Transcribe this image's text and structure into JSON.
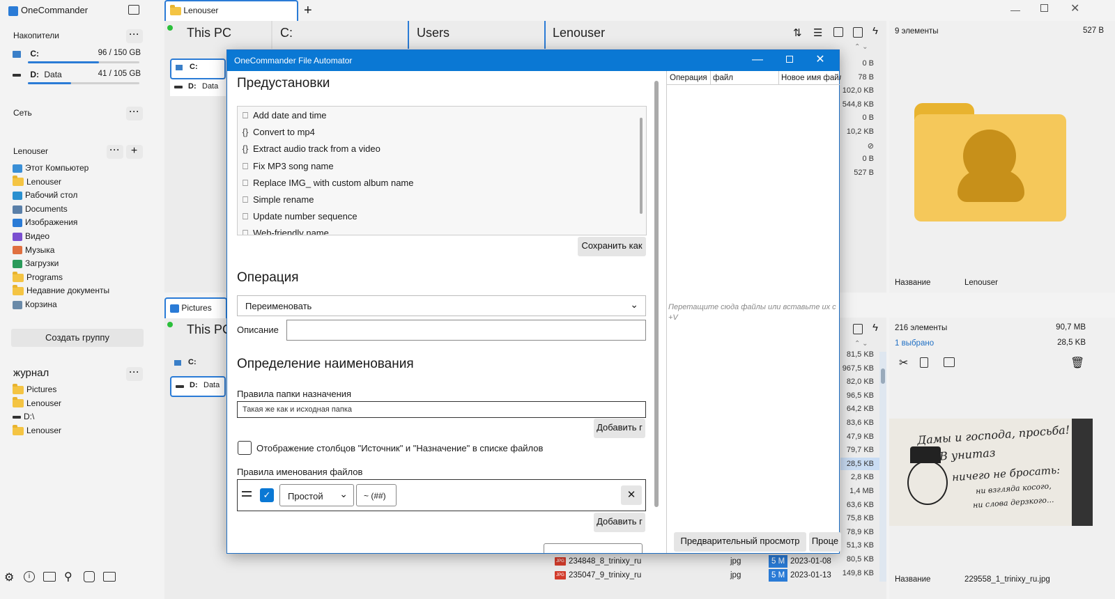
{
  "app": {
    "title": "OneCommander"
  },
  "sidebar": {
    "drives_header": "Накопители",
    "drives": [
      {
        "letter": "C:",
        "name": "",
        "usage": "96 / 150 GB",
        "fill": 0.64
      },
      {
        "letter": "D:",
        "name": "Data",
        "usage": "41 / 105 GB",
        "fill": 0.39
      }
    ],
    "network_header": "Сеть",
    "user_header": "Lenouser",
    "user_items": [
      {
        "label": "Этот Компьютер",
        "icon": "computer-icon"
      },
      {
        "label": "Lenouser",
        "icon": "folder-icon"
      },
      {
        "label": "Рабочий стол",
        "icon": "desktop-icon"
      },
      {
        "label": "Documents",
        "icon": "documents-icon"
      },
      {
        "label": "Изображения",
        "icon": "pictures-icon"
      },
      {
        "label": "Видео",
        "icon": "video-icon"
      },
      {
        "label": "Музыка",
        "icon": "music-icon"
      },
      {
        "label": "Загрузки",
        "icon": "downloads-icon"
      },
      {
        "label": "Programs",
        "icon": "folder-icon"
      },
      {
        "label": "Недавние документы",
        "icon": "folder-icon"
      },
      {
        "label": "Корзина",
        "icon": "recycle-bin-icon"
      }
    ],
    "create_group": "Создать группу",
    "journal_header": "журнал",
    "journal_items": [
      {
        "label": "Pictures",
        "icon": "folder-icon"
      },
      {
        "label": "Lenouser",
        "icon": "folder-icon"
      },
      {
        "label": "D:\\",
        "icon": "drive-icon"
      },
      {
        "label": "Lenouser",
        "icon": "folder-icon"
      }
    ]
  },
  "top_pane": {
    "tab_label": "Lenouser",
    "columns": [
      "This PC",
      "C:",
      "Users",
      "Lenouser"
    ],
    "drive_c": "C:",
    "drive_d": "D:",
    "drive_d_name": "Data",
    "sizes": [
      "0 B",
      "78 B",
      "102,0 KB",
      "544,8 KB",
      "0 B",
      "10,2 KB",
      "⊘",
      "0 B",
      "527 B"
    ]
  },
  "bottom_pane": {
    "tab_label": "Pictures",
    "column0": "This PC",
    "drive_c": "C:",
    "drive_d": "D:",
    "drive_d_name": "Data",
    "sizes": [
      "81,5 KB",
      "967,5 KB",
      "82,0 KB",
      "96,5 KB",
      "64,2 KB",
      "83,6 KB",
      "47,9 KB",
      "79,7 KB",
      "28,5 KB",
      "2,8 KB",
      "1,4 MB",
      "63,6 KB",
      "75,8 KB",
      "78,9 KB",
      "51,3 KB",
      "80,5 KB",
      "149,8 KB"
    ],
    "files": [
      {
        "name": "234848_8_trinixy_ru",
        "ext": "jpg",
        "badge": "5 M",
        "date": "2023-01-08"
      },
      {
        "name": "235047_9_trinixy_ru",
        "ext": "jpg",
        "badge": "5 M",
        "date": "2023-01-13"
      }
    ]
  },
  "right_top": {
    "count": "9 элементы",
    "size": "527 B",
    "name_label": "Название",
    "name_value": "Lenouser"
  },
  "right_bottom": {
    "count": "216 элементы",
    "size": "90,7 MB",
    "selected": "1 выбрано",
    "selected_size": "28,5 KB",
    "name_label": "Название",
    "name_value": "229558_1_trinixy_ru.jpg",
    "preview_text": [
      "Дамы и господа, просьба!",
      "В унитаз",
      "ничего не бросать:",
      "ни взгляда косого,",
      "ни слова дерзкого..."
    ]
  },
  "dialog": {
    "title": "OneCommander File Automator",
    "presets_header": "Предустановки",
    "presets": [
      {
        "icon": "book",
        "label": "Add date and time"
      },
      {
        "icon": "braces",
        "label": "Convert to mp4"
      },
      {
        "icon": "braces",
        "label": "Extract audio track from a video"
      },
      {
        "icon": "book",
        "label": "Fix MP3 song name"
      },
      {
        "icon": "book",
        "label": "Replace IMG_ with custom album name"
      },
      {
        "icon": "book",
        "label": "Simple rename"
      },
      {
        "icon": "book",
        "label": "Update number sequence"
      },
      {
        "icon": "book",
        "label": "Web-friendly name"
      }
    ],
    "save_as": "Сохранить как",
    "operation_header": "Операция",
    "operation_value": "Переименовать",
    "description_label": "Описание",
    "description_value": "",
    "naming_header": "Определение наименования",
    "dest_rules_label": "Правила папки назначения",
    "dest_rules_placeholder": "Такая же как и исходная папка",
    "add_button_1": "Добавить г",
    "show_columns_label": "Отображение столбцов \"Источник\" и \"Назначение\" в списке файлов",
    "show_columns_checked": false,
    "file_rules_label": "Правила именования файлов",
    "rule_type": "Простой",
    "rule_pattern": "~ (##)",
    "rule_checked": true,
    "add_button_2": "Добавить г",
    "table_headers": [
      "Операция",
      "файл",
      "Новое имя файл"
    ],
    "drop_hint": "Перетащите сюда файлы или вставьте их с",
    "drop_hint_2": "+V",
    "preview_button": "Предварительный просмотр",
    "process_button": "Проце"
  },
  "colors": {
    "accent": "#0a78d4",
    "selection": "#2a7bd6"
  }
}
